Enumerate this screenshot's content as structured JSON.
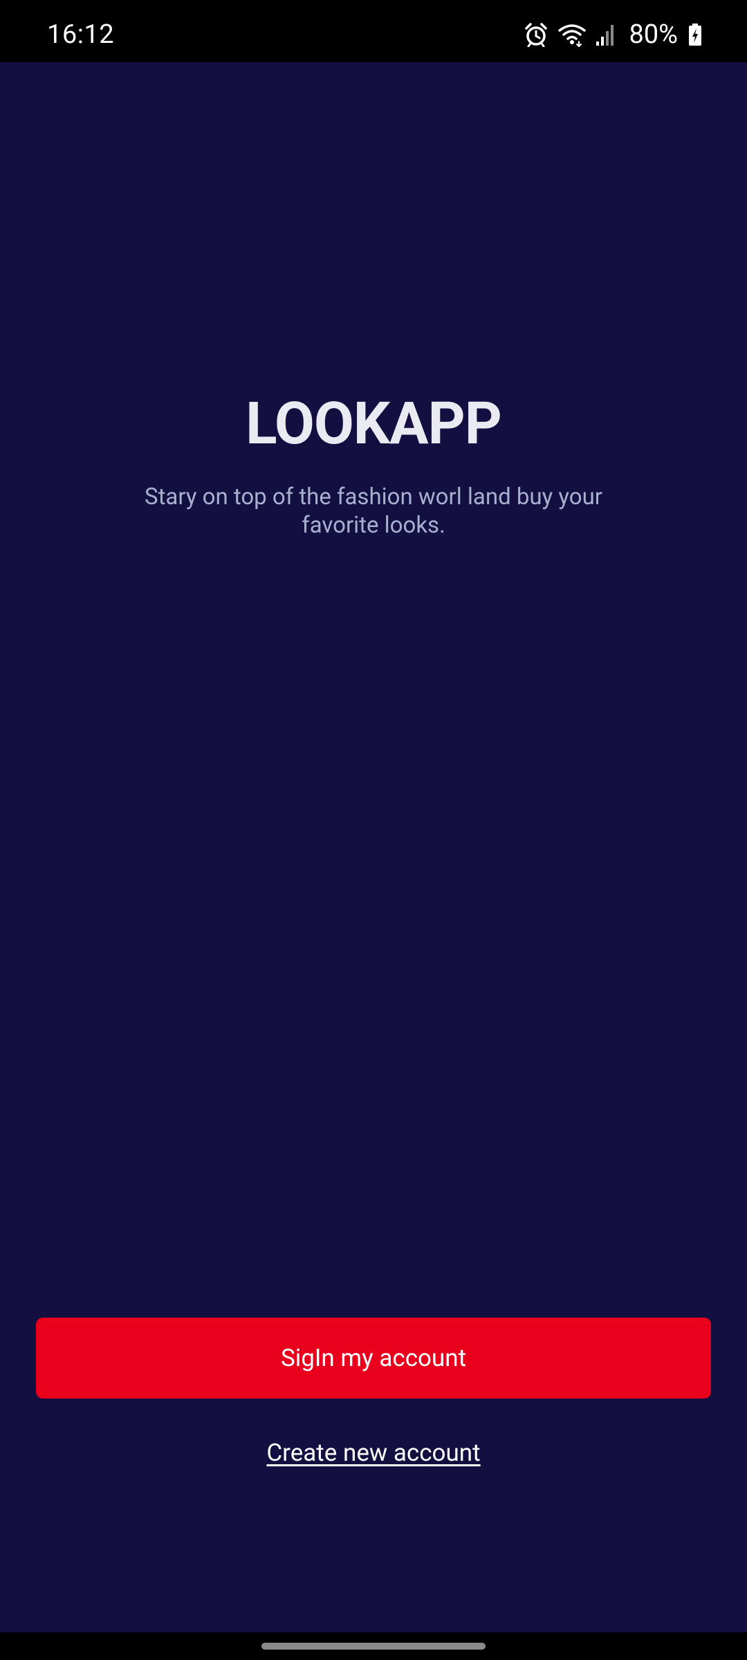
{
  "status_bar": {
    "time": "16:12",
    "battery_percent": "80%",
    "icons": [
      "alarm-icon",
      "wifi-icon",
      "signal-icon",
      "battery-charging-icon"
    ]
  },
  "app": {
    "title": "LOOKAPP",
    "subtitle": "Stary on top of the fashion worl land buy your favorite looks.",
    "signin_label": "SigIn my account",
    "create_account_label": "Create new account"
  },
  "colors": {
    "background": "#130f40",
    "primary_button": "#e8001c",
    "title_text": "#eaeaf2",
    "subtitle_text": "#a9b0cf"
  }
}
